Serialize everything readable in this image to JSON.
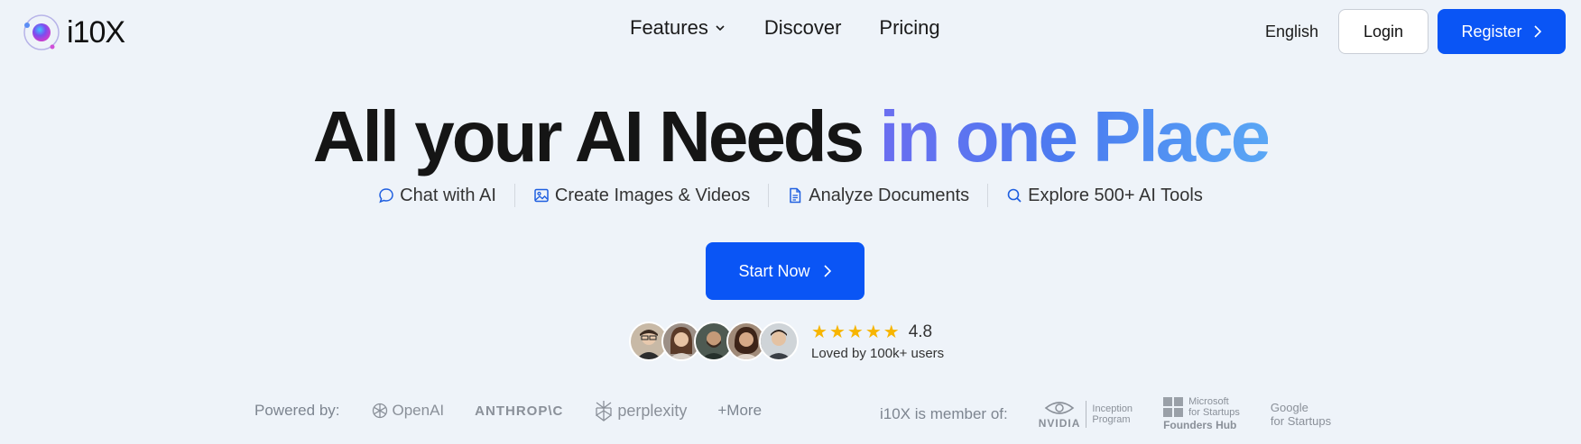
{
  "header": {
    "logo_text": "i10X",
    "nav": {
      "features": "Features",
      "discover": "Discover",
      "pricing": "Pricing"
    },
    "language": "English",
    "login_label": "Login",
    "register_label": "Register"
  },
  "hero": {
    "title_main": "All your AI Needs ",
    "title_accent": "in one Place",
    "features": [
      {
        "icon": "chat-bubble-icon",
        "label": "Chat with AI"
      },
      {
        "icon": "image-icon",
        "label": "Create Images & Videos"
      },
      {
        "icon": "document-icon",
        "label": "Analyze Documents"
      },
      {
        "icon": "search-icon",
        "label": "Explore 500+ AI Tools"
      }
    ],
    "cta_label": "Start Now"
  },
  "social_proof": {
    "rating": "4.8",
    "stars": 5,
    "loved_text": "Loved by 100k+ users"
  },
  "powered": {
    "label": "Powered by:",
    "brands": {
      "openai": "OpenAI",
      "anthropic": "ANTHROP\\C",
      "perplexity": "perplexity"
    },
    "more": "+More"
  },
  "member": {
    "label": "i10X is member of:",
    "nvidia": {
      "word": "NVIDIA",
      "line1": "Inception",
      "line2": "Program"
    },
    "microsoft": {
      "line1": "Microsoft",
      "line2": "for Startups",
      "line3": "Founders Hub"
    },
    "google": {
      "line1": "Google",
      "line2": "for Startups"
    }
  },
  "colors": {
    "primary": "#0a55f5",
    "background": "#eef3f9",
    "star": "#f7b500"
  }
}
